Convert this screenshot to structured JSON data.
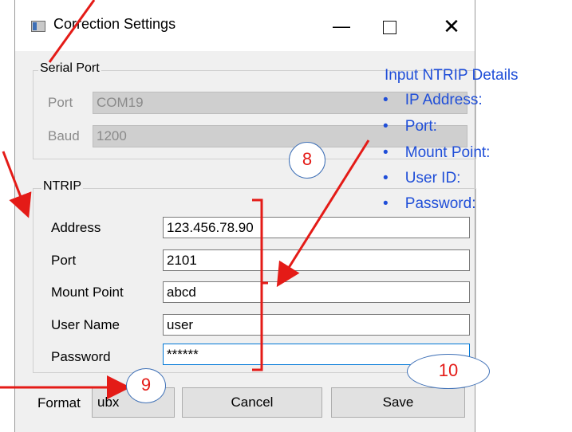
{
  "window": {
    "title": "Correction Settings",
    "controls": {
      "minimize": "—",
      "close": "✕"
    }
  },
  "serial_port": {
    "title": "Serial Port",
    "port_label": "Port",
    "port_value": "COM19",
    "baud_label": "Baud",
    "baud_value": "1200"
  },
  "ntrip": {
    "title": "NTRIP",
    "fields": [
      {
        "label": "Address",
        "value": "123.456.78.90"
      },
      {
        "label": "Port",
        "value": "2101"
      },
      {
        "label": "Mount Point",
        "value": "abcd"
      },
      {
        "label": "User Name",
        "value": "user"
      },
      {
        "label": "Password",
        "value": "******"
      }
    ]
  },
  "footer": {
    "format_label": "Format",
    "format_value": "ubx",
    "cancel_label": "Cancel",
    "save_label": "Save"
  },
  "annotations": {
    "heading": "Input NTRIP Details",
    "bullets": [
      "IP Address:",
      "Port:",
      "Mount Point:",
      "User ID:",
      "Password:"
    ],
    "steps": [
      "8",
      "9",
      "10"
    ],
    "bullet_char": "•"
  }
}
